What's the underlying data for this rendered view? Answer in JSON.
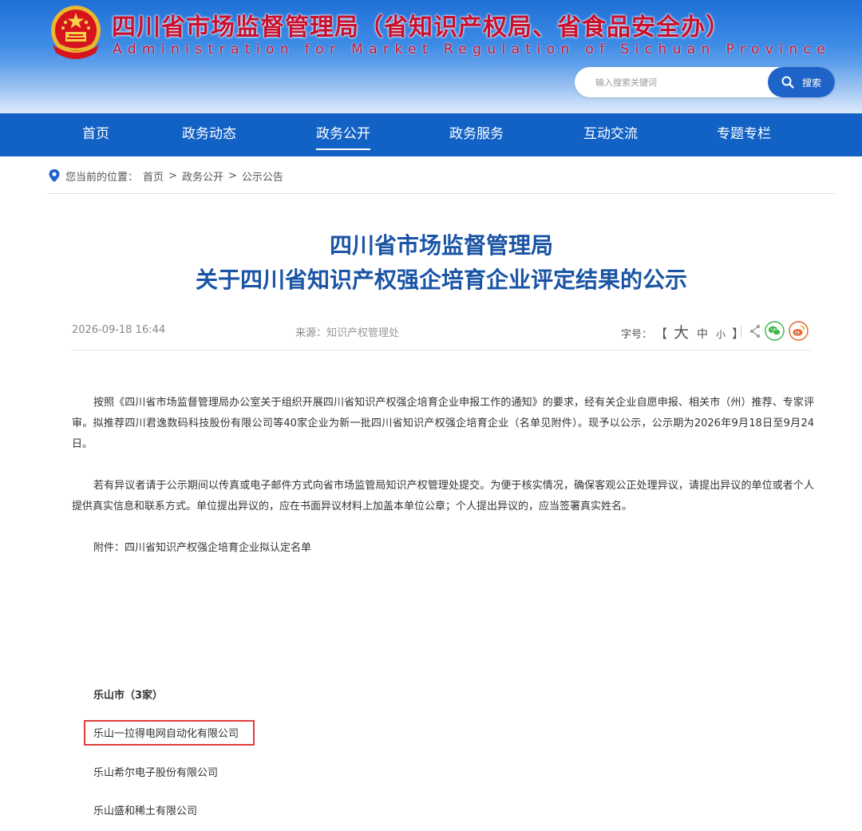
{
  "header": {
    "title": "四川省市场监督管理局（省知识产权局、省食品安全办）",
    "subtitle": "Administration for Market Regulation of Sichuan Province",
    "search": {
      "placeholder": "输入搜索关键词",
      "button_label": "搜索"
    },
    "colors": {
      "brand_red": "#c8102e",
      "nav_blue": "#1262c6",
      "title_blue": "#1a54a5"
    }
  },
  "nav": {
    "items": [
      {
        "label": "首页"
      },
      {
        "label": "政务动态"
      },
      {
        "label": "政务公开",
        "active": true
      },
      {
        "label": "政务服务"
      },
      {
        "label": "互动交流"
      },
      {
        "label": "专题专栏"
      }
    ]
  },
  "breadcrumb": {
    "prefix": "您当前的位置：",
    "items": [
      "首页",
      "政务公开",
      "公示公告"
    ],
    "separator": ">"
  },
  "article": {
    "title_line1": "四川省市场监督管理局",
    "title_line2": "关于四川省知识产权强企培育企业评定结果的公示",
    "date": "2026-09-18 16:44",
    "source_label": "来源：",
    "source_value": "知识产权管理处",
    "fontsize": {
      "label": "字号：",
      "open": "【",
      "big": "大",
      "mid": "中",
      "small": "小",
      "close": "】"
    },
    "paragraphs": [
      "按照《四川省市场监督管理局办公室关于组织开展四川省知识产权强企培育企业申报工作的通知》的要求，经有关企业自愿申报、相关市（州）推荐、专家评审。拟推荐四川君逸数码科技股份有限公司等40家企业为新一批四川省知识产权强企培育企业（名单见附件）。现予以公示，公示期为2026年9月18日至9月24日。",
      "若有异议者请于公示期间以传真或电子邮件方式向省市场监管局知识产权管理处提交。为便于核实情况，确保客观公正处理异议，请提出异议的单位或者个人提供真实信息和联系方式。单位提出异议的，应在书面异议材料上加盖本单位公章；个人提出异议的，应当签署真实姓名。",
      "附件：四川省知识产权强企培育企业拟认定名单"
    ],
    "region": "乐山市（3家）",
    "companies": [
      "乐山一拉得电网自动化有限公司",
      "乐山希尔电子股份有限公司",
      "乐山盛和稀土有限公司"
    ]
  }
}
